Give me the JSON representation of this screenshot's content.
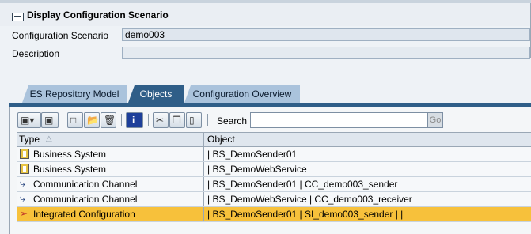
{
  "window": {
    "title": "Display Configuration Scenario"
  },
  "form": {
    "scenario_label": "Configuration Scenario",
    "scenario_value": "demo003",
    "description_label": "Description",
    "description_value": ""
  },
  "tabs": [
    {
      "label": "ES Repository Model",
      "active": false
    },
    {
      "label": "Objects",
      "active": true
    },
    {
      "label": "Configuration Overview",
      "active": false
    }
  ],
  "toolbar": {
    "search_label": "Search",
    "search_value": "",
    "go_label": "Go"
  },
  "table": {
    "headers": {
      "type": "Type",
      "type_sort": "△",
      "object": "Object"
    },
    "rows": [
      {
        "icon": "business-system-icon",
        "type": "Business System",
        "object": "| BS_DemoSender01",
        "selected": false
      },
      {
        "icon": "business-system-icon",
        "type": "Business System",
        "object": "| BS_DemoWebService",
        "selected": false
      },
      {
        "icon": "communication-channel-icon",
        "type": "Communication Channel",
        "object": "| BS_DemoSender01 | CC_demo003_sender",
        "selected": false
      },
      {
        "icon": "communication-channel-icon",
        "type": "Communication Channel",
        "object": "| BS_DemoWebService | CC_demo003_receiver",
        "selected": false
      },
      {
        "icon": "integrated-configuration-icon",
        "type": "Integrated Configuration",
        "object": "| BS_DemoSender01 | SI_demo003_sender |  |",
        "selected": true
      }
    ]
  },
  "colors": {
    "active_tab": "#2f5e88",
    "inactive_tab": "#aac3dc",
    "selected_row": "#f7c13b"
  }
}
